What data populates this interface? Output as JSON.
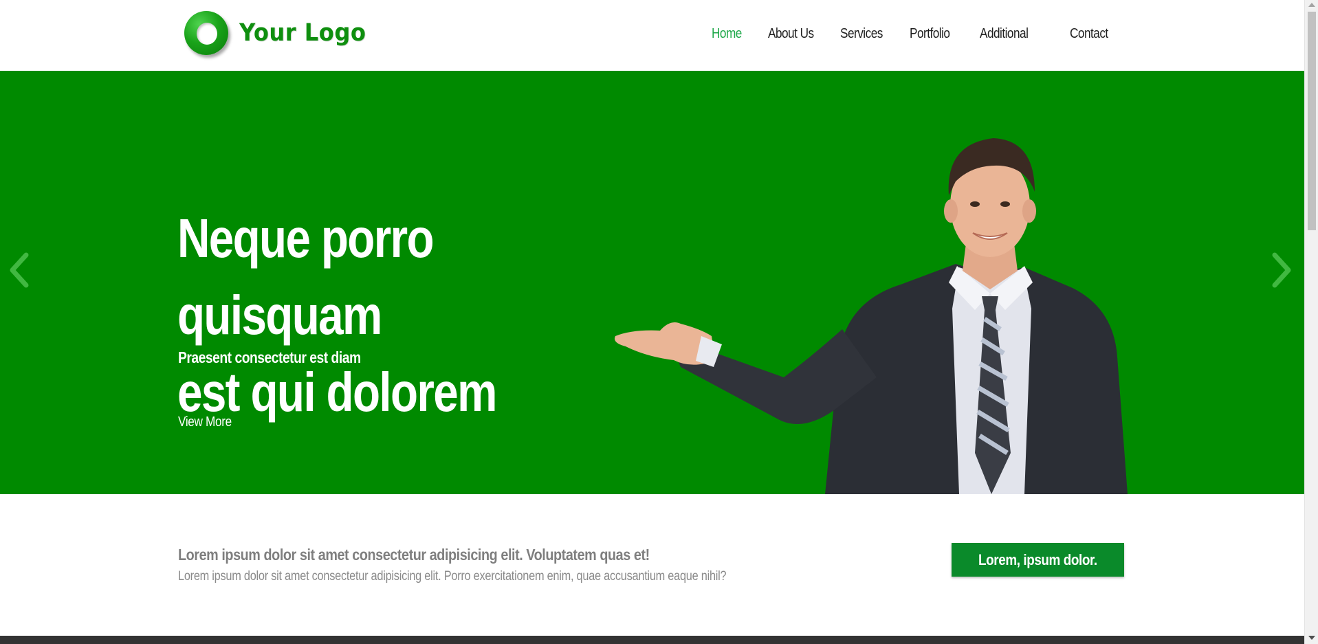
{
  "logo": {
    "text": "Your Logo",
    "icon": "ring-logo-icon"
  },
  "nav": {
    "items": [
      {
        "label": "Home",
        "active": true
      },
      {
        "label": "About Us",
        "active": false
      },
      {
        "label": "Services",
        "active": false
      },
      {
        "label": "Portfolio",
        "active": false
      },
      {
        "label": "Additional",
        "active": false
      },
      {
        "label": "Contact",
        "active": false
      }
    ]
  },
  "hero": {
    "title_line1": "Neque porro quisquam",
    "title_line2": "est qui dolorem",
    "subtitle": "Praesent consectetur est diam",
    "link_label": "View More",
    "prev_icon": "chevron-left-icon",
    "next_icon": "chevron-right-icon",
    "image": "businessman-presenting-photo"
  },
  "intro": {
    "heading": "Lorem ipsum dolor sit amet consectetur adipisicing elit. Voluptatem quas et!",
    "text": "Lorem ipsum dolor sit amet consectetur adipisicing elit. Porro exercitationem enim, quae accusantium eaque nihil?",
    "button_label": "Lorem, ipsum dolor."
  },
  "colors": {
    "brand_green": "#008a00",
    "nav_active": "#1fa84a",
    "button_green": "#0a8a2a",
    "text_gray": "#7f7f7f",
    "footer_dark": "#333333"
  }
}
